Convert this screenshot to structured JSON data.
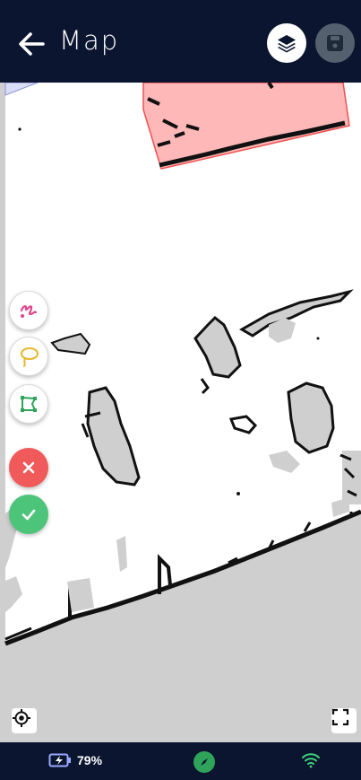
{
  "header": {
    "title": "Map",
    "back_icon": "arrow-left-icon",
    "layers_icon": "layers-icon",
    "save_icon": "floppy-disk-icon"
  },
  "tools": [
    {
      "name": "draw-path-tool",
      "icon": "scribble-icon",
      "color": "#e0468c"
    },
    {
      "name": "lasso-tool",
      "icon": "lasso-icon",
      "color": "#e5b72a"
    },
    {
      "name": "polygon-tool",
      "icon": "polygon-icon",
      "color": "#2fa35a"
    },
    {
      "name": "cancel-button",
      "icon": "close-icon",
      "color": "#f05a5a"
    },
    {
      "name": "confirm-button",
      "icon": "check-icon",
      "color": "#4cc47a"
    }
  ],
  "map": {
    "locate_icon": "crosshair-icon",
    "fullscreen_icon": "expand-icon",
    "zone_color": "#ffb3b3",
    "zone_border_color": "#f05050"
  },
  "status": {
    "battery_percent": "79%",
    "battery_icon": "battery-charging-icon",
    "compass_icon": "compass-icon",
    "wifi_icon": "wifi-icon"
  }
}
